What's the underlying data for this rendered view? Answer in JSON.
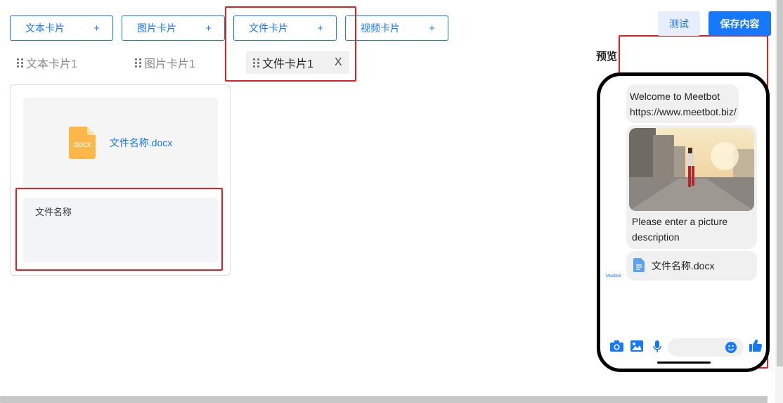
{
  "toolbar": {
    "add_buttons": [
      {
        "label": "文本卡片",
        "icon": "+"
      },
      {
        "label": "图片卡片",
        "icon": "+"
      },
      {
        "label": "文件卡片",
        "icon": "+"
      },
      {
        "label": "视频卡片",
        "icon": "+"
      }
    ],
    "test_label": "测试",
    "save_label": "保存内容"
  },
  "tabs": [
    {
      "label": "文本卡片1"
    },
    {
      "label": "图片卡片1"
    },
    {
      "label": "文件卡片1",
      "close": "X"
    }
  ],
  "file_card": {
    "icon_text": "docx",
    "file_link": "文件名称.docx",
    "name_value": "文件名称"
  },
  "preview": {
    "title": "预览",
    "avatar_label": "Meetbot",
    "text_bubble": {
      "line1": "Welcome to Meetbot",
      "line2": "https://www.meetbot.biz/"
    },
    "image_bubble": {
      "description": "Please enter a picture description"
    },
    "file_bubble": {
      "name": "文件名称.docx"
    }
  },
  "colors": {
    "accent": "#1677ff",
    "highlight": "#e02020",
    "file_icon": "#fbb849"
  }
}
